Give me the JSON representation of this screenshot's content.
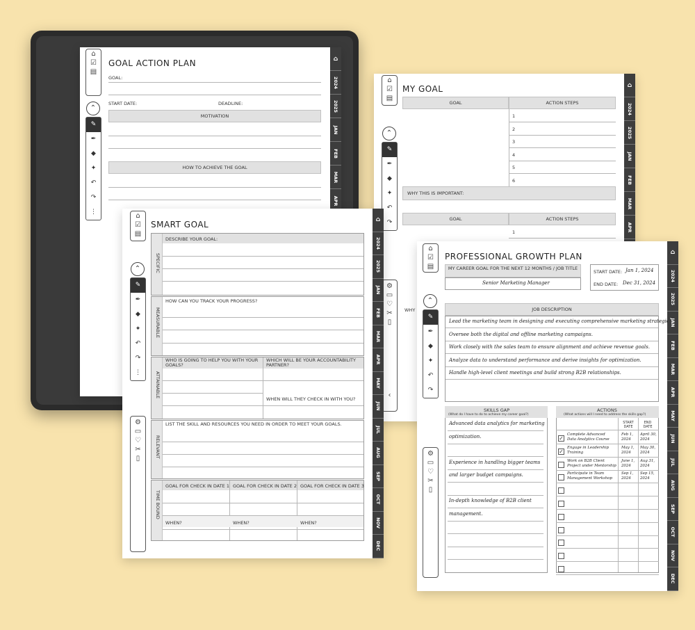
{
  "tabs_short": [
    "2024",
    "2025",
    "JAN",
    "FEB",
    "MAR",
    "APR"
  ],
  "tabs_full": [
    "2024",
    "2025",
    "JAN",
    "FEB",
    "MAR",
    "APR",
    "MAY",
    "JUN",
    "JUL",
    "AUG",
    "SEP",
    "OCT",
    "NOV",
    "DEC"
  ],
  "goal_action_plan": {
    "title": "GOAL ACTION PLAN",
    "goal_label": "GOAL:",
    "start_label": "START DATE:",
    "deadline_label": "DEADLINE:",
    "motivation": "MOTIVATION",
    "how_to": "HOW TO ACHIEVE THE GOAL"
  },
  "my_goal": {
    "title": "MY GOAL",
    "col_goal": "GOAL",
    "col_steps": "ACTION STEPS",
    "steps": [
      "1",
      "2",
      "3",
      "4",
      "5",
      "6"
    ],
    "why": "WHY THIS IS IMPORTANT:",
    "col_goal2": "GOAL",
    "col_steps2": "ACTION STEPS",
    "steps2": [
      "1"
    ],
    "why_cut": "WHY"
  },
  "smart_goal": {
    "title": "SMART GOAL",
    "specific": "SPECIFIC",
    "describe": "DESCRIBE YOUR GOAL:",
    "measurable": "MEASURABLE",
    "track": "HOW CAN YOU TRACK YOUR PROGRESS?",
    "attainable": "ATTAINABLE",
    "who_help": "WHO IS GOING TO HELP YOU WITH YOUR GOALS?",
    "accountability": "WHICH WILL BE YOUR ACCOUNTABILITY PARTNER?",
    "check_in": "WHEN WILL THEY CHECK IN WITH YOU?",
    "relevant": "RELEVANT",
    "skills": "LIST THE SKILL AND RESOURCES YOU NEED IN ORDER TO MEET YOUR GOALS.",
    "time_bound": "TIME BOUND",
    "check1": "GOAL FOR CHECK IN DATE 1",
    "check2": "GOAL FOR CHECK IN DATE 2",
    "check3": "GOAL FOR CHECK IN DATE 3",
    "when": "WHEN?"
  },
  "growth_plan": {
    "title": "PROFESSIONAL GROWTH PLAN",
    "career_label": "MY CAREER GOAL FOR THE NEXT 12 MONTHS / JOB TITLE",
    "job_title": "Senior Marketing Manager",
    "start_label": "START DATE:",
    "start_value": "Jan 1, 2024",
    "end_label": "END DATE:",
    "end_value": "Dec 31, 2024",
    "job_desc": "JOB DESCRIPTION",
    "desc_lines": [
      "Lead the marketing team in designing and executing comprehensive marketing strategies.",
      "Oversee both the digital and offline marketing campaigns.",
      "Work closely with the sales team to ensure alignment and achieve revenue goals.",
      "Analyze data to understand performance and derive insights for optimization.",
      "Handle high-level client meetings and build strong B2B relationships."
    ],
    "skills_gap": "SKILLS GAP",
    "skills_sub": "(What do I have to do to achieve my career goal?)",
    "skills": [
      "Advanced data analytics for marketing",
      "optimization.",
      "",
      "Experience in handling bigger teams",
      "and larger budget campaigns.",
      "",
      "In-depth knowledge of B2B client",
      "management."
    ],
    "actions": "ACTIONS",
    "actions_sub": "(What actions will I need to address the skills gap?)",
    "start_date": "START DATE",
    "end_date": "END DATE",
    "action_rows": [
      {
        "text1": "Complete Advanced",
        "text2": "Data Analytics Course",
        "s1": "Feb 1,",
        "s2": "2024",
        "e1": "April 30,",
        "e2": "2024",
        "checked": true
      },
      {
        "text1": "Engage in Leadership",
        "text2": "Training",
        "s1": "May 1,",
        "s2": "2024",
        "e1": "May 30,",
        "e2": "2024",
        "checked": true
      },
      {
        "text1": "Work on B2B Client",
        "text2": "Project under Mentorship",
        "s1": "June 1,",
        "s2": "2024",
        "e1": "Aug 31,",
        "e2": "2024",
        "checked": false
      },
      {
        "text1": "Participate in Team",
        "text2": "Management Workshop",
        "s1": "Sep 1,",
        "s2": "2024",
        "e1": "Sep 15,",
        "e2": "2024",
        "checked": false
      }
    ]
  }
}
